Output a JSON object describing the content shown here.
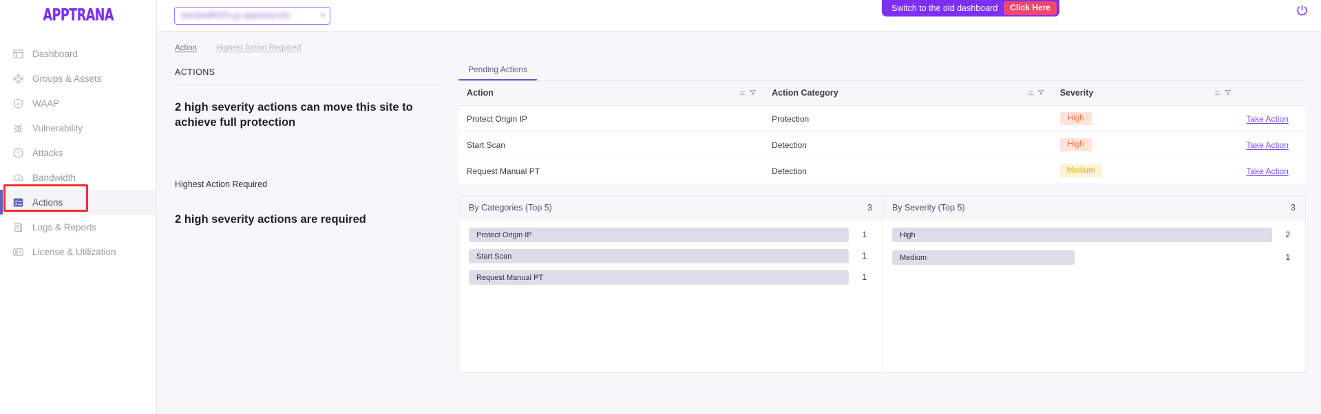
{
  "brand": {
    "name": "APPTRANA"
  },
  "sidebar": {
    "items": [
      {
        "label": "Dashboard",
        "icon": "dashboard-icon",
        "active": false
      },
      {
        "label": "Groups & Assets",
        "icon": "nodes-icon",
        "active": false
      },
      {
        "label": "WAAP",
        "icon": "shield-check-icon",
        "active": false
      },
      {
        "label": "Vulnerability",
        "icon": "bug-icon",
        "active": false
      },
      {
        "label": "Attacks",
        "icon": "alert-circle-icon",
        "active": false
      },
      {
        "label": "Bandwidth",
        "icon": "gauge-icon",
        "active": false
      },
      {
        "label": "Actions",
        "icon": "checklist-icon",
        "active": true
      },
      {
        "label": "Logs & Reports",
        "icon": "logs-icon",
        "active": false
      },
      {
        "label": "License & Utilization",
        "icon": "license-card-icon",
        "active": false
      }
    ]
  },
  "topbar": {
    "domain_selector": {
      "value": "bandwidth001.gc.apptrana.info",
      "caret": "▾"
    },
    "switch_banner": {
      "text": "Switch to the old dashboard",
      "button_label": "Click Here"
    },
    "power_icon": "power-icon"
  },
  "anchors": [
    {
      "label": "Action",
      "active": true
    },
    {
      "label": "Highest Action Required",
      "active": false
    }
  ],
  "summary": {
    "actions": {
      "title": "ACTIONS",
      "body": "2 high severity actions can move this site to achieve full protection"
    },
    "highest": {
      "title": "Highest Action Required",
      "body": "2 high severity actions are required"
    }
  },
  "tabs": [
    {
      "label": "Pending Actions",
      "active": true
    }
  ],
  "table": {
    "columns": [
      "Action",
      "Action Category",
      "Severity",
      ""
    ],
    "rows": [
      {
        "action": "Protect Origin IP",
        "category": "Protection",
        "severity": "High",
        "severity_level": "high",
        "link": "Take Action"
      },
      {
        "action": "Start Scan",
        "category": "Detection",
        "severity": "High",
        "severity_level": "high",
        "link": "Take Action"
      },
      {
        "action": "Request Manual PT",
        "category": "Detection",
        "severity": "Medium",
        "severity_level": "medium",
        "link": "Take Action"
      }
    ]
  },
  "chart_data": [
    {
      "type": "bar",
      "title": "By Categories (Top 5)",
      "total": "3",
      "categories": [
        "Protect Origin IP",
        "Start Scan",
        "Request Manual PT"
      ],
      "values": [
        1,
        1,
        1
      ],
      "xlabel": "",
      "ylabel": "",
      "orientation": "horizontal",
      "max": 1,
      "grid": false,
      "legend": "none"
    },
    {
      "type": "bar",
      "title": "By Severity (Top 5)",
      "total": "3",
      "categories": [
        "High",
        "Medium"
      ],
      "values": [
        2,
        1
      ],
      "xlabel": "",
      "ylabel": "",
      "orientation": "horizontal",
      "max": 2,
      "grid": false,
      "legend": "none"
    }
  ],
  "colors": {
    "brand_purple": "#7b2ff7",
    "banner_purple": "#7b2ff7",
    "cta_pink": "#f8456b",
    "accent_indigo": "#5b5fc7",
    "link_purple": "#7b4fe0",
    "high_badge_bg": "#fde4d8",
    "high_badge_text": "#f0743a",
    "medium_badge_bg": "#fdf3d2",
    "medium_badge_text": "#e0a92a",
    "bar_fill": "#dddce9",
    "annotation_red": "#fb2c2c"
  }
}
